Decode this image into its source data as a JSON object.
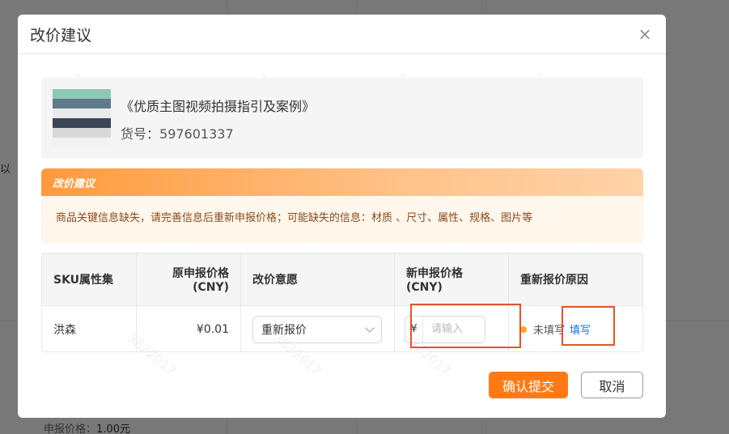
{
  "modal": {
    "title": "改价建议",
    "close_glyph": "×"
  },
  "product": {
    "name": "《优质主图视频拍摄指引及案例》",
    "sku_label": "货号：",
    "sku_value": "597601337"
  },
  "suggestion": {
    "title": "改价建议",
    "text": "商品关键信息缺失，请完善信息后重新申报价格；可能缺失的信息：材质 、尺寸、属性、规格、图片等"
  },
  "table": {
    "headers": {
      "sku_attr": "SKU属性集",
      "orig_price_1": "原申报价格",
      "orig_price_2": "(CNY)",
      "intent": "改价意愿",
      "new_price_1": "新申报价格",
      "new_price_2": "(CNY)",
      "reason": "重新报价原因"
    },
    "row": {
      "sku_attr": "洪森",
      "orig_price": "¥0.01",
      "intent_selected": "重新报价",
      "currency": "¥",
      "new_price_value": "",
      "new_price_placeholder": "请输入",
      "reason_status": "未填写",
      "reason_link": "填写"
    }
  },
  "footer": {
    "confirm": "确认提交",
    "cancel": "取消"
  },
  "background": {
    "fragment": "以",
    "price_label": "申报价格：",
    "price_value": "1.00元"
  },
  "watermark": "3822017",
  "colors": {
    "accent": "#ff7a14",
    "link": "#1a73e8",
    "highlight": "#e8522a",
    "status_dot": "#f5a623"
  }
}
